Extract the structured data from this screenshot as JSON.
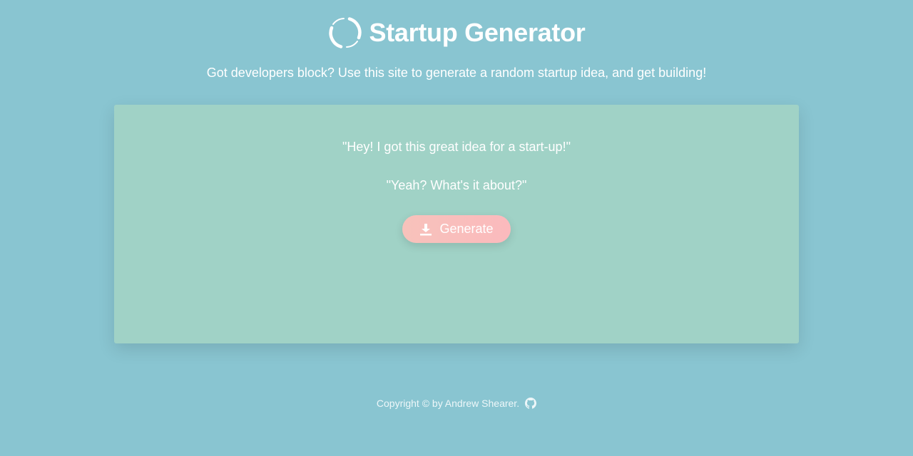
{
  "header": {
    "title": "Startup Generator",
    "logo_icon": "circular-arrows-icon"
  },
  "subtitle": "Got developers block? Use this site to generate a random startup idea, and get building!",
  "card": {
    "quote_1": "\"Hey! I got this great idea for a start-up!\"",
    "quote_2": "\"Yeah? What's it about?\"",
    "generate_button": {
      "label": "Generate",
      "icon": "download-icon"
    }
  },
  "footer": {
    "copyright": "Copyright © by Andrew Shearer.",
    "icon": "github-icon"
  },
  "colors": {
    "background": "#89c5d1",
    "card": "#a0d2c6",
    "button": "#f9bebb",
    "text": "#ffffff"
  }
}
